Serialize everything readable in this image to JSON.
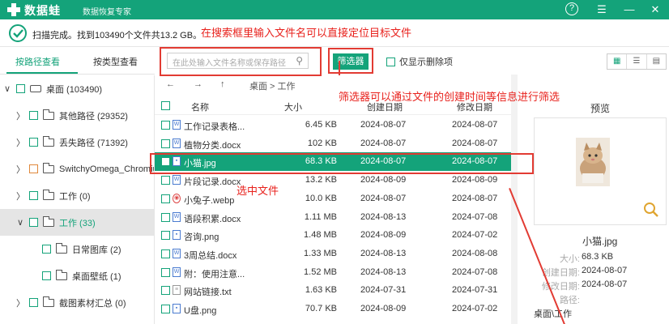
{
  "app": {
    "name": "数据蛙",
    "subtitle": "数据恢复专家"
  },
  "window_controls": {
    "help": "?",
    "menu": "☰",
    "minimize": "—",
    "close": "✕"
  },
  "status": {
    "text": "扫描完成。找到103490个文件共13.2 GB。"
  },
  "annotations": {
    "search_tip": "在搜索框里输入文件名可以直接定位目标文件",
    "filter_tip": "筛选器可以通过文件的创建时间等信息进行筛选",
    "selected_tip": "选中文件"
  },
  "left_tabs": {
    "by_path": "按路径查看",
    "by_type": "按类型查看"
  },
  "tree": [
    {
      "label": "桌面 (103490)",
      "arrow": "∨",
      "icon": "drive",
      "indent": 0,
      "selected": false,
      "orange": false
    },
    {
      "label": "其他路径 (29352)",
      "arrow": "〉",
      "icon": "folder",
      "indent": 1,
      "selected": false,
      "orange": false
    },
    {
      "label": "丢失路径 (71392)",
      "arrow": "〉",
      "icon": "folder",
      "indent": 1,
      "selected": false,
      "orange": false
    },
    {
      "label": "SwitchyOmega_Chromium",
      "arrow": "〉",
      "icon": "folder",
      "indent": 1,
      "selected": false,
      "orange": true
    },
    {
      "label": "工作 (0)",
      "arrow": "〉",
      "icon": "folder",
      "indent": 1,
      "selected": false,
      "orange": false
    },
    {
      "label": "工作 (33)",
      "arrow": "∨",
      "icon": "folder",
      "indent": 1,
      "selected": true,
      "orange": false
    },
    {
      "label": "日常图库 (2)",
      "arrow": "",
      "icon": "folder",
      "indent": 2,
      "selected": false,
      "orange": false
    },
    {
      "label": "桌面壁纸 (1)",
      "arrow": "",
      "icon": "folder",
      "indent": 2,
      "selected": false,
      "orange": false
    },
    {
      "label": "截图素材汇总 (0)",
      "arrow": "〉",
      "icon": "folder",
      "indent": 1,
      "selected": false,
      "orange": false
    }
  ],
  "toolbar": {
    "search_placeholder": "在此处输入文件名称或保存路径",
    "filter_label": "筛选器",
    "only_deleted_label": "仅显示删除项",
    "view_icons": [
      "▦",
      "☰",
      "▤"
    ]
  },
  "nav": {
    "back": "←",
    "forward": "→",
    "up": "↑",
    "breadcrumb": "桌面 > 工作"
  },
  "file_table": {
    "headers": {
      "name": "名称",
      "size": "大小",
      "created": "创建日期",
      "modified": "修改日期"
    },
    "rows": [
      {
        "name": "工作记录表格....",
        "size": "6.45 KB",
        "created": "2024-08-07",
        "modified": "2024-08-07",
        "icon": "doc",
        "selected": false
      },
      {
        "name": "植物分类.docx",
        "size": "102 KB",
        "created": "2024-08-07",
        "modified": "2024-08-07",
        "icon": "doc",
        "selected": false
      },
      {
        "name": "小猫.jpg",
        "size": "68.3 KB",
        "created": "2024-08-07",
        "modified": "2024-08-07",
        "icon": "img",
        "selected": true
      },
      {
        "name": "片段记录.docx",
        "size": "13.2 KB",
        "created": "2024-08-09",
        "modified": "2024-08-09",
        "icon": "doc",
        "selected": false
      },
      {
        "name": "小兔子.webp",
        "size": "10.0 KB",
        "created": "2024-08-07",
        "modified": "2024-08-07",
        "icon": "web",
        "selected": false
      },
      {
        "name": "语段积累.docx",
        "size": "1.11 MB",
        "created": "2024-08-13",
        "modified": "2024-07-08",
        "icon": "doc",
        "selected": false
      },
      {
        "name": "咨询.png",
        "size": "1.48 MB",
        "created": "2024-08-09",
        "modified": "2024-07-02",
        "icon": "img",
        "selected": false
      },
      {
        "name": "3周总结.docx",
        "size": "1.33 MB",
        "created": "2024-08-13",
        "modified": "2024-08-08",
        "icon": "doc",
        "selected": false
      },
      {
        "name": "附：使用注意...",
        "size": "1.52 MB",
        "created": "2024-08-13",
        "modified": "2024-07-08",
        "icon": "doc",
        "selected": false
      },
      {
        "name": "网站链接.txt",
        "size": "1.63 KB",
        "created": "2024-07-31",
        "modified": "2024-07-31",
        "icon": "txt",
        "selected": false
      },
      {
        "name": "U盘.png",
        "size": "70.7 KB",
        "created": "2024-08-09",
        "modified": "2024-07-02",
        "icon": "img",
        "selected": false
      }
    ]
  },
  "preview": {
    "title": "预览",
    "file_name": "小猫.jpg",
    "details": [
      {
        "key": "大小:",
        "value": "68.3 KB"
      },
      {
        "key": "创建日期:",
        "value": "2024-08-07"
      },
      {
        "key": "修改日期:",
        "value": "2024-08-07"
      },
      {
        "key": "路径:",
        "value": ""
      },
      {
        "key": "",
        "value": "桌面\\工作"
      }
    ]
  },
  "colors": {
    "brand": "#14a37a",
    "annotation": "#e8211c",
    "selected_row": "#14a37a"
  }
}
